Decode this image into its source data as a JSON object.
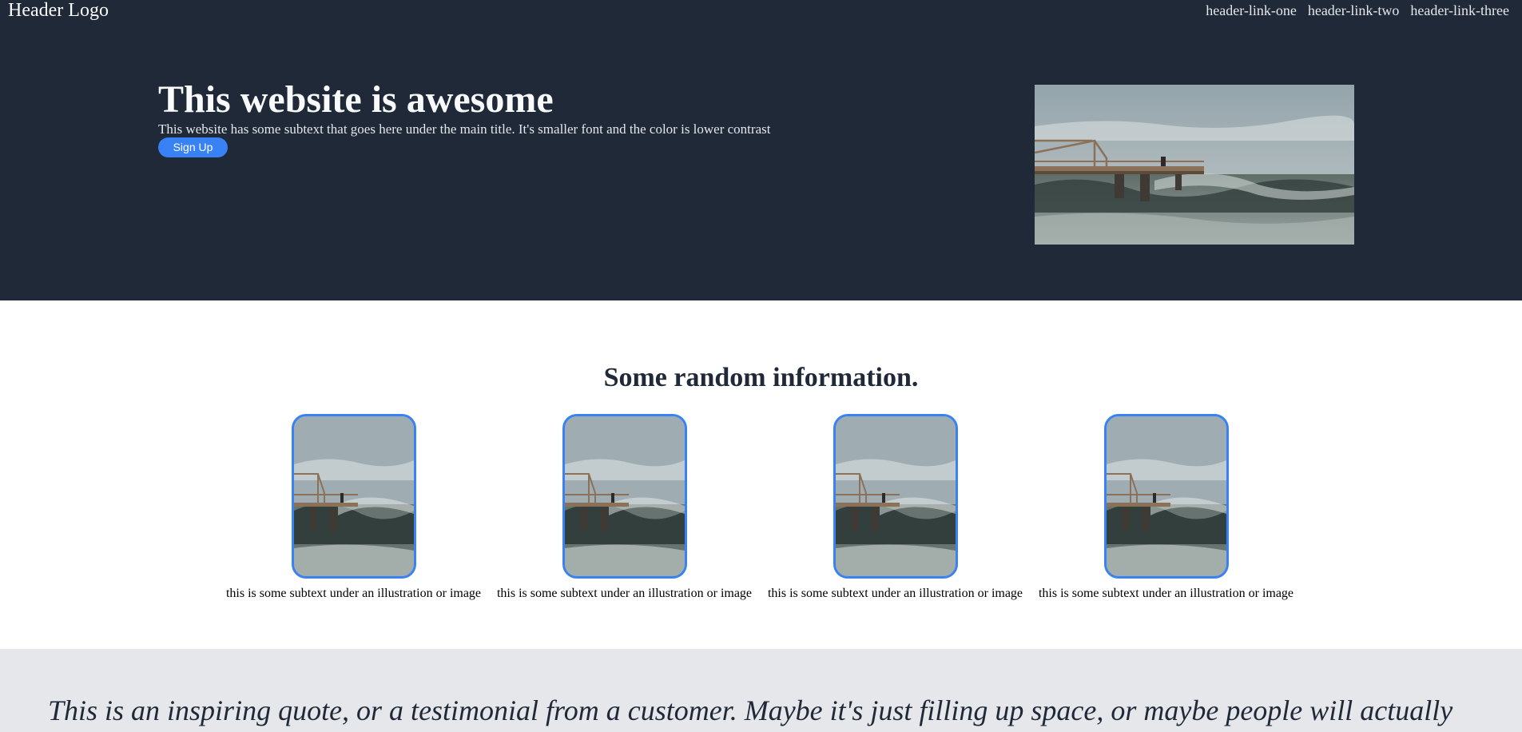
{
  "header": {
    "logo": "Header Logo",
    "links": [
      "header-link-one",
      "header-link-two",
      "header-link-three"
    ]
  },
  "hero": {
    "title": "This website is awesome",
    "subtitle": "This website has some subtext that goes here under the main title. It's smaller font and the color is lower contrast",
    "cta_label": "Sign Up"
  },
  "info": {
    "title": "Some random information.",
    "cards": [
      {
        "caption": "this is some subtext under an illustration or image"
      },
      {
        "caption": "this is some subtext under an illustration or image"
      },
      {
        "caption": "this is some subtext under an illustration or image"
      },
      {
        "caption": "this is some subtext under an illustration or image"
      }
    ]
  },
  "quote": {
    "text": "This is an inspiring quote, or a testimonial from a customer. Maybe it's just filling up space, or maybe people will actually"
  },
  "colors": {
    "hero_bg": "#1f2937",
    "accent": "#3882f6",
    "quote_bg": "#e5e7eb"
  }
}
